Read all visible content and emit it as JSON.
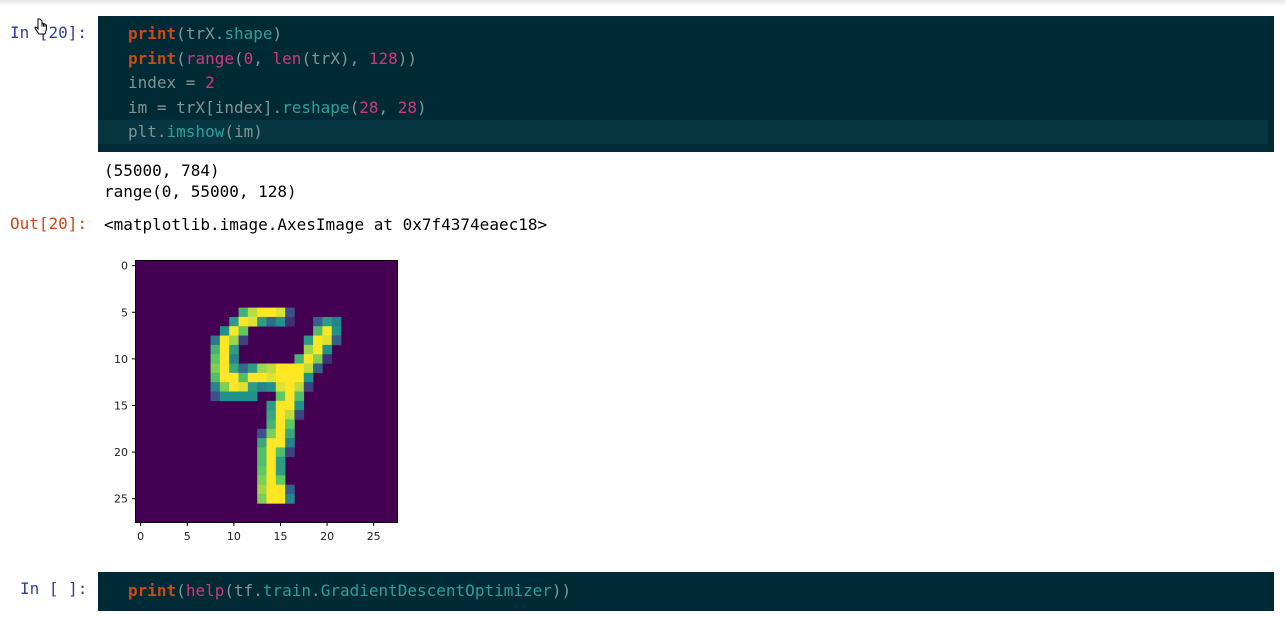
{
  "cells": [
    {
      "prompt": "In [20]:",
      "code": [
        [
          [
            "print",
            "kw"
          ],
          [
            "(",
            "plain"
          ],
          [
            "trX",
            "plain"
          ],
          [
            ".",
            "plain"
          ],
          [
            "shape",
            "attr"
          ],
          [
            ")",
            "plain"
          ]
        ],
        [
          [
            "print",
            "kw"
          ],
          [
            "(",
            "plain"
          ],
          [
            "range",
            "bi"
          ],
          [
            "(",
            "plain"
          ],
          [
            "0",
            "num"
          ],
          [
            ", ",
            "plain"
          ],
          [
            "len",
            "bi"
          ],
          [
            "(trX), ",
            "plain"
          ],
          [
            "128",
            "num"
          ],
          [
            "))",
            "plain"
          ]
        ],
        [
          [
            "index = ",
            "plain"
          ],
          [
            "2",
            "num"
          ]
        ],
        [
          [
            "im = trX[index].",
            "plain"
          ],
          [
            "reshape",
            "attr"
          ],
          [
            "(",
            "plain"
          ],
          [
            "28",
            "num"
          ],
          [
            ", ",
            "plain"
          ],
          [
            "28",
            "num"
          ],
          [
            ")",
            "plain"
          ]
        ],
        [
          [
            "plt.",
            "plain"
          ],
          [
            "imshow",
            "attr"
          ],
          [
            "(im)",
            "plain"
          ]
        ]
      ],
      "stdout": [
        "(55000, 784)",
        "range(0, 55000, 128)"
      ],
      "out_prompt": "Out[20]:",
      "out_text": "<matplotlib.image.AxesImage at 0x7f4374eaec18>"
    },
    {
      "prompt": "In [ ]:",
      "code": [
        [
          [
            "print",
            "kw"
          ],
          [
            "(",
            "plain"
          ],
          [
            "help",
            "bi"
          ],
          [
            "(tf.",
            "plain"
          ],
          [
            "train",
            "attr"
          ],
          [
            ".",
            "plain"
          ],
          [
            "GradientDescentOptimizer",
            "attr"
          ],
          [
            "))",
            "plain"
          ]
        ]
      ]
    }
  ],
  "chart_data": {
    "type": "heatmap",
    "title": "",
    "xlabel": "",
    "ylabel": "",
    "colormap": "viridis",
    "xlim": [
      -0.5,
      27.5
    ],
    "ylim": [
      27.5,
      -0.5
    ],
    "xticks": [
      0,
      5,
      10,
      15,
      20,
      25
    ],
    "yticks": [
      0,
      5,
      10,
      15,
      20,
      25
    ],
    "xtick_labels": [
      "0",
      "5",
      "10",
      "15",
      "20",
      "25"
    ],
    "ytick_labels": [
      "0",
      "5",
      "10",
      "15",
      "20",
      "25"
    ],
    "pixels": [
      [
        5,
        11,
        0.65
      ],
      [
        5,
        12,
        0.9
      ],
      [
        5,
        13,
        1
      ],
      [
        5,
        14,
        1
      ],
      [
        5,
        15,
        0.95
      ],
      [
        5,
        16,
        0.25
      ],
      [
        6,
        10,
        0.55
      ],
      [
        6,
        11,
        1
      ],
      [
        6,
        12,
        0.95
      ],
      [
        6,
        13,
        0.55
      ],
      [
        6,
        14,
        0.35
      ],
      [
        6,
        15,
        0.5
      ],
      [
        6,
        16,
        0.15
      ],
      [
        6,
        19,
        0.3
      ],
      [
        6,
        20,
        0.55
      ],
      [
        6,
        21,
        0.45
      ],
      [
        7,
        9,
        0.5
      ],
      [
        7,
        10,
        1
      ],
      [
        7,
        11,
        0.75
      ],
      [
        7,
        19,
        0.7
      ],
      [
        7,
        20,
        1
      ],
      [
        7,
        21,
        0.5
      ],
      [
        8,
        8,
        0.4
      ],
      [
        8,
        9,
        1
      ],
      [
        8,
        10,
        0.85
      ],
      [
        8,
        11,
        0.2
      ],
      [
        8,
        18,
        0.55
      ],
      [
        8,
        19,
        1
      ],
      [
        8,
        20,
        0.95
      ],
      [
        8,
        21,
        0.3
      ],
      [
        9,
        8,
        0.65
      ],
      [
        9,
        9,
        1
      ],
      [
        9,
        10,
        0.55
      ],
      [
        9,
        18,
        0.85
      ],
      [
        9,
        19,
        1
      ],
      [
        9,
        20,
        0.5
      ],
      [
        10,
        8,
        0.75
      ],
      [
        10,
        9,
        1
      ],
      [
        10,
        10,
        0.45
      ],
      [
        10,
        17,
        0.65
      ],
      [
        10,
        18,
        1
      ],
      [
        10,
        19,
        0.8
      ],
      [
        10,
        20,
        0.15
      ],
      [
        11,
        8,
        0.8
      ],
      [
        11,
        9,
        1
      ],
      [
        11,
        10,
        0.6
      ],
      [
        11,
        11,
        0.35
      ],
      [
        11,
        12,
        0.55
      ],
      [
        11,
        13,
        0.85
      ],
      [
        11,
        14,
        0.9
      ],
      [
        11,
        15,
        1
      ],
      [
        11,
        16,
        1
      ],
      [
        11,
        17,
        1
      ],
      [
        11,
        18,
        0.9
      ],
      [
        11,
        19,
        0.3
      ],
      [
        12,
        8,
        0.7
      ],
      [
        12,
        9,
        1
      ],
      [
        12,
        10,
        1
      ],
      [
        12,
        11,
        0.7
      ],
      [
        12,
        12,
        1
      ],
      [
        12,
        13,
        1
      ],
      [
        12,
        14,
        0.95
      ],
      [
        12,
        15,
        1
      ],
      [
        12,
        16,
        1
      ],
      [
        12,
        17,
        1
      ],
      [
        12,
        18,
        0.5
      ],
      [
        13,
        8,
        0.45
      ],
      [
        13,
        9,
        0.8
      ],
      [
        13,
        10,
        1
      ],
      [
        13,
        11,
        0.95
      ],
      [
        13,
        12,
        0.55
      ],
      [
        13,
        13,
        0.45
      ],
      [
        13,
        14,
        0.5
      ],
      [
        13,
        15,
        0.95
      ],
      [
        13,
        16,
        1
      ],
      [
        13,
        17,
        0.9
      ],
      [
        13,
        18,
        0.2
      ],
      [
        14,
        8,
        0.25
      ],
      [
        14,
        9,
        0.5
      ],
      [
        14,
        10,
        0.5
      ],
      [
        14,
        11,
        0.5
      ],
      [
        14,
        12,
        0.5
      ],
      [
        14,
        15,
        0.75
      ],
      [
        14,
        16,
        1
      ],
      [
        14,
        17,
        0.7
      ],
      [
        15,
        14,
        0.55
      ],
      [
        15,
        15,
        1
      ],
      [
        15,
        16,
        1
      ],
      [
        15,
        17,
        0.5
      ],
      [
        16,
        14,
        0.6
      ],
      [
        16,
        15,
        1
      ],
      [
        16,
        16,
        0.9
      ],
      [
        16,
        17,
        0.2
      ],
      [
        17,
        14,
        0.65
      ],
      [
        17,
        15,
        1
      ],
      [
        17,
        16,
        0.75
      ],
      [
        18,
        13,
        0.25
      ],
      [
        18,
        14,
        0.8
      ],
      [
        18,
        15,
        1
      ],
      [
        18,
        16,
        0.6
      ],
      [
        19,
        13,
        0.6
      ],
      [
        19,
        14,
        1
      ],
      [
        19,
        15,
        1
      ],
      [
        19,
        16,
        0.45
      ],
      [
        20,
        13,
        0.7
      ],
      [
        20,
        14,
        1
      ],
      [
        20,
        15,
        0.7
      ],
      [
        20,
        16,
        0.2
      ],
      [
        21,
        13,
        0.7
      ],
      [
        21,
        14,
        1
      ],
      [
        21,
        15,
        0.55
      ],
      [
        22,
        13,
        0.75
      ],
      [
        22,
        14,
        1
      ],
      [
        22,
        15,
        0.55
      ],
      [
        23,
        13,
        0.8
      ],
      [
        23,
        14,
        1
      ],
      [
        23,
        15,
        0.75
      ],
      [
        24,
        13,
        0.85
      ],
      [
        24,
        14,
        1
      ],
      [
        24,
        15,
        1
      ],
      [
        24,
        16,
        0.3
      ],
      [
        25,
        13,
        0.8
      ],
      [
        25,
        14,
        1
      ],
      [
        25,
        15,
        1
      ],
      [
        25,
        16,
        0.45
      ]
    ]
  }
}
